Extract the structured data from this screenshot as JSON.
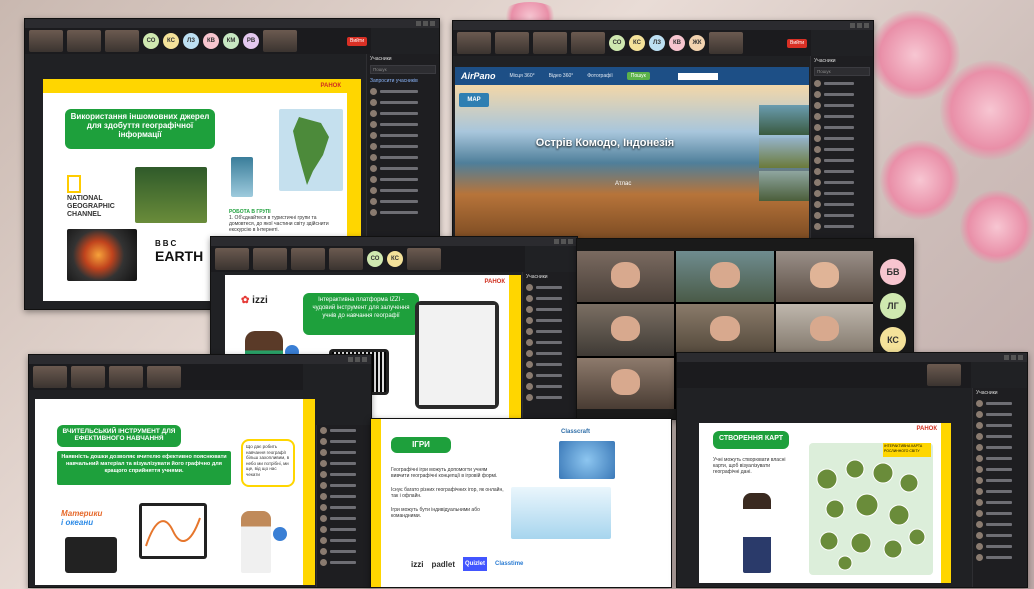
{
  "colors": {
    "accent_green": "#1ea03c",
    "accent_yellow": "#ffd600",
    "zoom_dark": "#202124",
    "leave_red": "#d93025"
  },
  "participants_title": "Учасники",
  "search_placeholder": "Пошук",
  "invite_label": "Запросити учасників",
  "leave_label": "Вийти",
  "strip_initials": [
    "СО",
    "КС",
    "ЛЗ",
    "КВ",
    "ЖК",
    "КМ",
    "РВ",
    "ШС"
  ],
  "gallery_initials": [
    "БВ",
    "ЛГ",
    "КС",
    "ШС"
  ],
  "screen1": {
    "ranok": "РАНОК",
    "title": "Використання іншомовних джерел для здобуття географічної інформації",
    "ng_line1": "NATIONAL",
    "ng_line2": "GEOGRAPHIC",
    "ng_line3": "CHANNEL",
    "bbc": "BBC",
    "earth": "EARTH",
    "task_title": "РОБОТА В ГРУПІ",
    "task_text": "1. Об'єднайтеся в туристичні групи та домовтеся, до якої частини світу здійснити екскурсію в Інтернеті."
  },
  "screen2": {
    "logo": "AirPano",
    "nav": [
      "Місця 360°",
      "Відео 360°",
      "Фотографії",
      "Пошук"
    ],
    "map_label": "MAP",
    "caption": "Острів Комодо, Індонезія",
    "sub": "Атлас"
  },
  "screen3": {
    "ranok": "РАНОК",
    "heading": "Інтерактивна платформа IZZI - чудовий інструмент для залучення учнів до навчання географії",
    "izzi": "izzi"
  },
  "screen5": {
    "heading": "ВЧИТЕЛЬСЬКИЙ ІНСТРУМЕНТ ДЛЯ ЕФЕКТИВНОГО НАВЧАННЯ",
    "body": "Наявність дошки дозволяє вчителю ефективно пояснювати навчальний матеріал та візуалізувати його графічно для кращого сприйняття учнями.",
    "bubble": "Що дає робить навчання географії більш захопливим, в небо ми потрібні, ми ще, від що нас чекати",
    "mainland1": "Материки",
    "mainland2": "і океани"
  },
  "screen6": {
    "heading": "ІГРИ",
    "classcraft": "Classcraft",
    "bullets": [
      "Географічні ігри можуть допомогти учням вивчити географічні концепції в ігровій формі.",
      "Існує багато різних географічних ігор, як онлайн, так і офлайн.",
      "Ігри можуть бути індивідуальними або командними."
    ],
    "logos": [
      "izzi",
      "padlet",
      "Quizlet",
      "Classtime"
    ]
  },
  "screen7": {
    "ranok": "РАНОК",
    "heading": "СТВОРЕННЯ КАРТ",
    "body": "Учні можуть створювати власні карти, щоб візуалізувати географічні дані.",
    "note": "ІНТЕРАКТИВНА КАРТА РОСЛИННОГО СВІТУ"
  }
}
